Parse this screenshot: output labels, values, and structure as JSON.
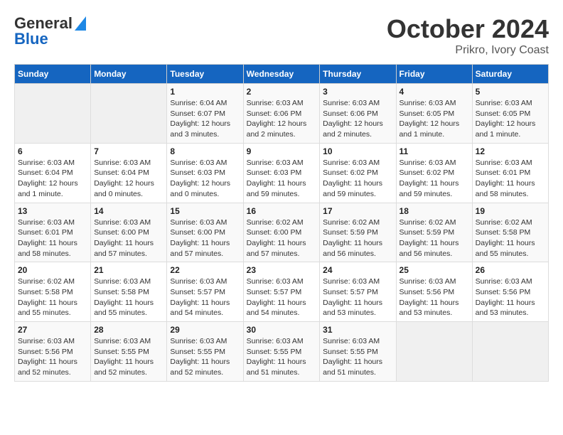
{
  "logo": {
    "line1": "General",
    "line2": "Blue"
  },
  "title": "October 2024",
  "subtitle": "Prikro, Ivory Coast",
  "days_of_week": [
    "Sunday",
    "Monday",
    "Tuesday",
    "Wednesday",
    "Thursday",
    "Friday",
    "Saturday"
  ],
  "weeks": [
    [
      {
        "day": "",
        "info": ""
      },
      {
        "day": "",
        "info": ""
      },
      {
        "day": "1",
        "info": "Sunrise: 6:04 AM\nSunset: 6:07 PM\nDaylight: 12 hours and 3 minutes."
      },
      {
        "day": "2",
        "info": "Sunrise: 6:03 AM\nSunset: 6:06 PM\nDaylight: 12 hours and 2 minutes."
      },
      {
        "day": "3",
        "info": "Sunrise: 6:03 AM\nSunset: 6:06 PM\nDaylight: 12 hours and 2 minutes."
      },
      {
        "day": "4",
        "info": "Sunrise: 6:03 AM\nSunset: 6:05 PM\nDaylight: 12 hours and 1 minute."
      },
      {
        "day": "5",
        "info": "Sunrise: 6:03 AM\nSunset: 6:05 PM\nDaylight: 12 hours and 1 minute."
      }
    ],
    [
      {
        "day": "6",
        "info": "Sunrise: 6:03 AM\nSunset: 6:04 PM\nDaylight: 12 hours and 1 minute."
      },
      {
        "day": "7",
        "info": "Sunrise: 6:03 AM\nSunset: 6:04 PM\nDaylight: 12 hours and 0 minutes."
      },
      {
        "day": "8",
        "info": "Sunrise: 6:03 AM\nSunset: 6:03 PM\nDaylight: 12 hours and 0 minutes."
      },
      {
        "day": "9",
        "info": "Sunrise: 6:03 AM\nSunset: 6:03 PM\nDaylight: 11 hours and 59 minutes."
      },
      {
        "day": "10",
        "info": "Sunrise: 6:03 AM\nSunset: 6:02 PM\nDaylight: 11 hours and 59 minutes."
      },
      {
        "day": "11",
        "info": "Sunrise: 6:03 AM\nSunset: 6:02 PM\nDaylight: 11 hours and 59 minutes."
      },
      {
        "day": "12",
        "info": "Sunrise: 6:03 AM\nSunset: 6:01 PM\nDaylight: 11 hours and 58 minutes."
      }
    ],
    [
      {
        "day": "13",
        "info": "Sunrise: 6:03 AM\nSunset: 6:01 PM\nDaylight: 11 hours and 58 minutes."
      },
      {
        "day": "14",
        "info": "Sunrise: 6:03 AM\nSunset: 6:00 PM\nDaylight: 11 hours and 57 minutes."
      },
      {
        "day": "15",
        "info": "Sunrise: 6:03 AM\nSunset: 6:00 PM\nDaylight: 11 hours and 57 minutes."
      },
      {
        "day": "16",
        "info": "Sunrise: 6:02 AM\nSunset: 6:00 PM\nDaylight: 11 hours and 57 minutes."
      },
      {
        "day": "17",
        "info": "Sunrise: 6:02 AM\nSunset: 5:59 PM\nDaylight: 11 hours and 56 minutes."
      },
      {
        "day": "18",
        "info": "Sunrise: 6:02 AM\nSunset: 5:59 PM\nDaylight: 11 hours and 56 minutes."
      },
      {
        "day": "19",
        "info": "Sunrise: 6:02 AM\nSunset: 5:58 PM\nDaylight: 11 hours and 55 minutes."
      }
    ],
    [
      {
        "day": "20",
        "info": "Sunrise: 6:02 AM\nSunset: 5:58 PM\nDaylight: 11 hours and 55 minutes."
      },
      {
        "day": "21",
        "info": "Sunrise: 6:03 AM\nSunset: 5:58 PM\nDaylight: 11 hours and 55 minutes."
      },
      {
        "day": "22",
        "info": "Sunrise: 6:03 AM\nSunset: 5:57 PM\nDaylight: 11 hours and 54 minutes."
      },
      {
        "day": "23",
        "info": "Sunrise: 6:03 AM\nSunset: 5:57 PM\nDaylight: 11 hours and 54 minutes."
      },
      {
        "day": "24",
        "info": "Sunrise: 6:03 AM\nSunset: 5:57 PM\nDaylight: 11 hours and 53 minutes."
      },
      {
        "day": "25",
        "info": "Sunrise: 6:03 AM\nSunset: 5:56 PM\nDaylight: 11 hours and 53 minutes."
      },
      {
        "day": "26",
        "info": "Sunrise: 6:03 AM\nSunset: 5:56 PM\nDaylight: 11 hours and 53 minutes."
      }
    ],
    [
      {
        "day": "27",
        "info": "Sunrise: 6:03 AM\nSunset: 5:56 PM\nDaylight: 11 hours and 52 minutes."
      },
      {
        "day": "28",
        "info": "Sunrise: 6:03 AM\nSunset: 5:55 PM\nDaylight: 11 hours and 52 minutes."
      },
      {
        "day": "29",
        "info": "Sunrise: 6:03 AM\nSunset: 5:55 PM\nDaylight: 11 hours and 52 minutes."
      },
      {
        "day": "30",
        "info": "Sunrise: 6:03 AM\nSunset: 5:55 PM\nDaylight: 11 hours and 51 minutes."
      },
      {
        "day": "31",
        "info": "Sunrise: 6:03 AM\nSunset: 5:55 PM\nDaylight: 11 hours and 51 minutes."
      },
      {
        "day": "",
        "info": ""
      },
      {
        "day": "",
        "info": ""
      }
    ]
  ]
}
